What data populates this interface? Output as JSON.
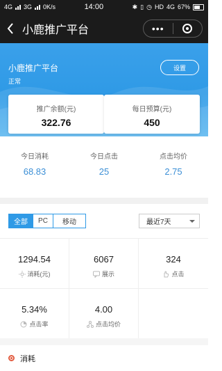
{
  "status": {
    "network_left": "4G",
    "network_right": "3G",
    "speed": "0K/s",
    "time": "14:00",
    "hd_label": "HD",
    "network_4g": "4G",
    "battery": "67%"
  },
  "nav": {
    "title": "小鹿推广平台",
    "more_label": "•••"
  },
  "hero": {
    "title": "小鹿推广平台",
    "status": "正常",
    "settings_label": "设置"
  },
  "cards": [
    {
      "label": "推广余额(元)",
      "value": "322.76"
    },
    {
      "label": "每日预算(元)",
      "value": "450"
    }
  ],
  "today": [
    {
      "label": "今日消耗",
      "value": "68.83"
    },
    {
      "label": "今日点击",
      "value": "25"
    },
    {
      "label": "点击均价",
      "value": "2.75"
    }
  ],
  "filter": {
    "tabs": [
      "全部",
      "PC",
      "移动"
    ],
    "active_tab": "全部",
    "date_range": "最近7天"
  },
  "metrics": [
    {
      "value": "1294.54",
      "label": "消耗(元)",
      "icon": "sun-icon"
    },
    {
      "value": "6067",
      "label": "展示",
      "icon": "chat-icon"
    },
    {
      "value": "324",
      "label": "点击",
      "icon": "hand-icon"
    },
    {
      "value": "5.34%",
      "label": "点击率",
      "icon": "pie-icon"
    },
    {
      "value": "4.00",
      "label": "点击均价",
      "icon": "nodes-icon"
    }
  ],
  "footer": {
    "label": "消耗"
  },
  "colors": {
    "accent": "#2f9ae6",
    "value_blue": "#3c8fd6",
    "footer_dot": "#e25b3f"
  }
}
